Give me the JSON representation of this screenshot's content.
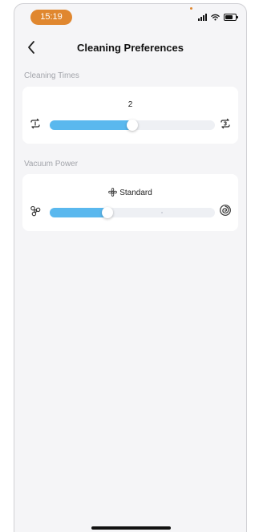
{
  "status_bar": {
    "time": "15:19"
  },
  "nav": {
    "title": "Cleaning Preferences"
  },
  "cleaning_times": {
    "section_label": "Cleaning Times",
    "value": "2",
    "level_fraction": 0.5,
    "min_icon": "repeat-1-icon",
    "max_icon": "repeat-3-icon"
  },
  "vacuum_power": {
    "section_label": "Vacuum Power",
    "value": "Standard",
    "level_fraction": 0.35,
    "icon": "fan-icon",
    "min_icon": "fan-low-icon",
    "max_icon": "turbo-vortex-icon"
  },
  "colors": {
    "accent": "#5ab8ee",
    "time_pill": "#e0872f"
  }
}
